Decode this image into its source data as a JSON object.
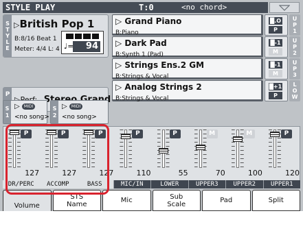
{
  "header": {
    "title": "STYLE PLAY",
    "tempo_label": "T:0",
    "chord": "<no chord>",
    "menu_icon": "triangle-down-icon"
  },
  "style": {
    "side_tag": [
      "S",
      "T",
      "Y",
      "L",
      "E"
    ],
    "indicator": "▷",
    "name": "British Pop 1",
    "time_sig_beat": "B:8/16 Beat 1",
    "meter": "Meter: 4/4  L: 4",
    "tempo_value": "94",
    "tempo_note": "♩="
  },
  "perf": {
    "side_tag": [
      "P",
      "S"
    ],
    "indicator": "▷",
    "label": "Perf:",
    "name": "Stereo Grand"
  },
  "songs": [
    {
      "tag": [
        "S",
        "1"
      ],
      "indicator": "▷",
      "midi": "MIDI",
      "song": "<no song>"
    },
    {
      "tag": [
        "S",
        "2"
      ],
      "indicator": "▷",
      "midi": "MIDI",
      "song": "<no song>"
    }
  ],
  "upper_sounds": [
    {
      "name": "▷ Grand Piano",
      "bank": "B:Piano",
      "btn1": "█.O",
      "btn2": "P",
      "tag": [
        "U",
        "P",
        "1"
      ]
    },
    {
      "name": "▷ Dark Pad",
      "bank": "B:Synth 1 (Pad)",
      "btn1": "█-1",
      "btn2": "M",
      "tag": [
        "U",
        "P",
        "2"
      ]
    },
    {
      "name": "▷ Strings Ens.2 GM",
      "bank": "B:Strings & Vocal",
      "btn1": "█-1",
      "btn2": "M",
      "tag": [
        "U",
        "P",
        "3"
      ]
    },
    {
      "name": "▷ Analog Strings 2",
      "bank": "B:Strings & Vocal",
      "btn1": "█+1",
      "btn2": "P",
      "tag": [
        "L",
        "O",
        "W"
      ]
    }
  ],
  "mixer": {
    "channels": [
      {
        "label": "DR/PERC",
        "value": "127",
        "btn": "P",
        "level": 1.0
      },
      {
        "label": "ACCOMP",
        "value": "127",
        "btn": "P",
        "level": 1.0
      },
      {
        "label": "BASS",
        "value": "127",
        "btn": "P",
        "level": 1.0
      },
      {
        "label": "MIC/IN",
        "value": "110",
        "btn": "P",
        "level": 0.866
      },
      {
        "label": "LOWER",
        "value": "55",
        "btn": "P",
        "level": 0.433
      },
      {
        "label": "UPPER3",
        "value": "70",
        "btn": "M",
        "level": 0.551
      },
      {
        "label": "UPPER2",
        "value": "100",
        "btn": "M",
        "level": 0.787
      },
      {
        "label": "UPPER1",
        "value": "120",
        "btn": "P",
        "level": 0.945
      }
    ]
  },
  "tabs": [
    {
      "label": "Volume",
      "active": true
    },
    {
      "label": "STS\nName",
      "active": false
    },
    {
      "label": "Mic",
      "active": false
    },
    {
      "label": "Sub\nScale",
      "active": false
    },
    {
      "label": "Pad",
      "active": false
    },
    {
      "label": "Split",
      "active": false
    }
  ],
  "colors": {
    "highlight": "#d9232e",
    "dark": "#3f4650",
    "panel": "#dcdfe3"
  }
}
